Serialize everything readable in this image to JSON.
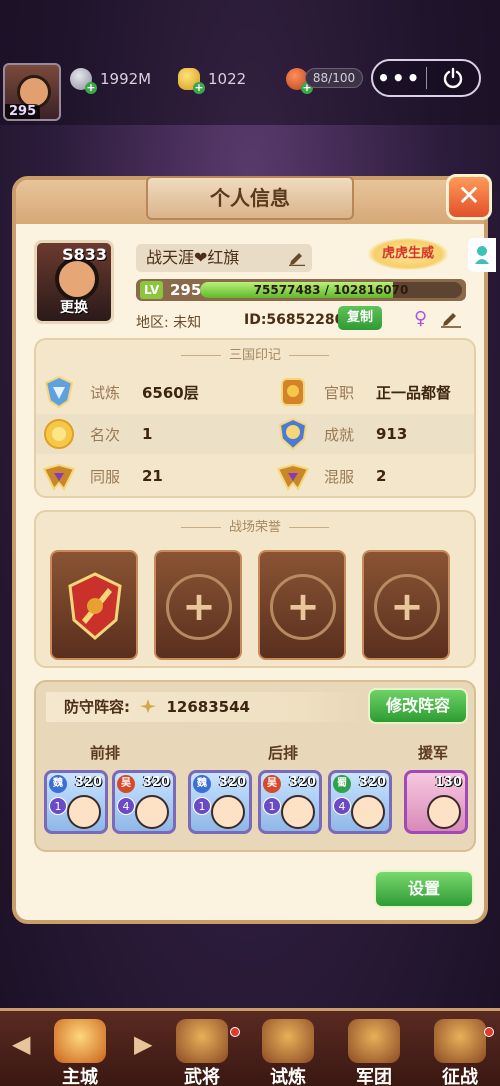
{
  "topbar": {
    "player_level": "295",
    "silver": "1992M",
    "ingot": "1022",
    "stamina": "88/100",
    "more_label": "•••"
  },
  "panel": {
    "title": "个人信息",
    "close_label": "✕",
    "server_id": "S833",
    "change_label": "更换",
    "player_name": "战天涯❤红旗",
    "vip_badge": "虎虎生威",
    "lv_tag": "LV",
    "level": "295",
    "exp_text": "75577483 / 102816070",
    "exp_progress": 0.735,
    "region": "地区: 未知",
    "player_id": "ID:56852280",
    "copy_label": "复制",
    "gender_symbol": "♀"
  },
  "seals": {
    "title": "三国印记",
    "rows": [
      [
        {
          "label": "试炼",
          "value": "6560层"
        },
        {
          "label": "官职",
          "value": "正一品都督"
        }
      ],
      [
        {
          "label": "名次",
          "value": "1"
        },
        {
          "label": "成就",
          "value": "913"
        }
      ],
      [
        {
          "label": "同服",
          "value": "21"
        },
        {
          "label": "混服",
          "value": "2"
        }
      ]
    ]
  },
  "honor": {
    "title": "战场荣誉",
    "add_symbol": "+"
  },
  "defense": {
    "label": "防守阵容:",
    "power": "12683544",
    "modify_label": "修改阵容",
    "front_label": "前排",
    "back_label": "后排",
    "support_label": "援军",
    "heroes": [
      {
        "faction": "魏",
        "stars": "1",
        "level": "320",
        "faction_color": "#3b6fd6"
      },
      {
        "faction": "吴",
        "stars": "4",
        "level": "320",
        "faction_color": "#d64a2a"
      },
      {
        "faction": "魏",
        "stars": "1",
        "level": "320",
        "faction_color": "#3b6fd6"
      },
      {
        "faction": "吴",
        "stars": "1",
        "level": "320",
        "faction_color": "#d64a2a"
      },
      {
        "faction": "蜀",
        "stars": "4",
        "level": "320",
        "faction_color": "#2ea14a"
      },
      {
        "faction": "",
        "stars": "",
        "level": "130",
        "faction_color": "#a04ab8"
      }
    ]
  },
  "settings_label": "设置",
  "nav": {
    "main_city": "主城",
    "generals": "武将",
    "trial": "试炼",
    "legion": "军团",
    "campaign": "征战"
  }
}
